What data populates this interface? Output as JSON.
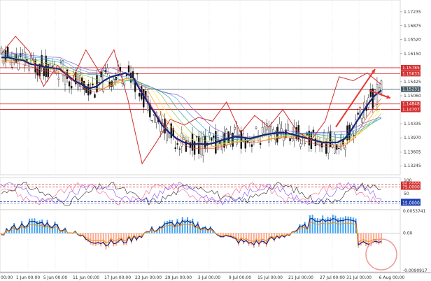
{
  "chart_data": [
    {
      "type": "line",
      "panel": "price",
      "y_ticks": [
        "1.17235",
        "1.16875",
        "1.16520",
        "1.16150",
        "1.15785",
        "1.15425",
        "1.15060",
        "1.14695",
        "1.14335",
        "1.13970",
        "1.13605",
        "1.13245"
      ],
      "ylim": [
        1.1305,
        1.1745
      ],
      "resistance_levels": [
        {
          "label": "1.15785",
          "value": 1.15785,
          "color": "#d32f2f"
        },
        {
          "label": "1.15633",
          "value": 1.15633,
          "color": "#d32f2f"
        },
        {
          "label": "1.15231",
          "value": 1.15231,
          "color": "#455a64"
        },
        {
          "label": "1.14848",
          "value": 1.14848,
          "color": "#d32f2f"
        },
        {
          "label": "1.14707",
          "value": 1.14707,
          "color": "#d32f2f"
        }
      ],
      "x_labels": [
        "00:00",
        "1 Jun 00:00",
        "5 Jun 00:00",
        "11 Jun 00:00",
        "17 Jun 00:00",
        "23 Jun 00:00",
        "29 Jun 00:00",
        "3 Jul 00:00",
        "9 Jul 00:00",
        "15 Jul 00:00",
        "21 Jul 00:00",
        "27 Jul 00:00",
        "31 Jul 00:00",
        "6 Aug 00:00"
      ],
      "ma_thick": [
        1.1605,
        1.1605,
        1.16,
        1.1598,
        1.1588,
        1.1585,
        1.158,
        1.1578,
        1.1575,
        1.156,
        1.1545,
        1.1535,
        1.1525,
        1.153,
        1.1545,
        1.1555,
        1.156,
        1.1565,
        1.1555,
        1.152,
        1.149,
        1.146,
        1.143,
        1.141,
        1.1395,
        1.1385,
        1.138,
        1.1382,
        1.138,
        1.1383,
        1.139,
        1.1395,
        1.14,
        1.1398,
        1.1395,
        1.14,
        1.1405,
        1.1408,
        1.141,
        1.141,
        1.1405,
        1.14,
        1.1395,
        1.139,
        1.1385,
        1.1385,
        1.1385,
        1.1395,
        1.142,
        1.145,
        1.148,
        1.1505,
        1.152
      ],
      "zigzag": [
        1.1615,
        1.166,
        1.162,
        1.153,
        1.1585,
        1.1545,
        1.1625,
        1.1565,
        1.1625,
        1.1495,
        1.133,
        1.1385,
        1.1445,
        1.143,
        1.145,
        1.144,
        1.149,
        1.141,
        1.1455,
        1.1425,
        1.147,
        1.1415,
        1.139,
        1.144,
        1.1555,
        1.1545,
        1.1565,
        1.1535
      ],
      "trend_arrows": [
        {
          "from": [
            1.1425,
            1.1425
          ],
          "to": [
            1.1545,
            1.1575
          ],
          "color": "#e53935"
        },
        {
          "from": [
            1.152,
            1.153
          ],
          "to": [
            1.1565,
            1.15
          ],
          "color": "#e53935"
        }
      ]
    },
    {
      "type": "line",
      "panel": "oscillator",
      "y_ticks": [
        "100",
        "85.0000",
        "75.0000",
        "50",
        "20.0000",
        "15.0000"
      ],
      "ylim": [
        0,
        100
      ],
      "levels": [
        {
          "label": "85.0000",
          "value": 85,
          "color": "#d32f2f"
        },
        {
          "label": "75.0000",
          "value": 75,
          "color": "#d32f2f"
        },
        {
          "label": "20.0000",
          "value": 20,
          "color": "#1e40af"
        },
        {
          "label": "15.0000",
          "value": 15,
          "color": "#1e40af"
        }
      ]
    },
    {
      "type": "bar",
      "panel": "histogram",
      "y_ticks": [
        "0.0053741",
        "0.00",
        "-0.0090917"
      ],
      "ylim": [
        -0.0090917,
        0.0053741
      ],
      "annotation": "circled recent histogram"
    }
  ]
}
